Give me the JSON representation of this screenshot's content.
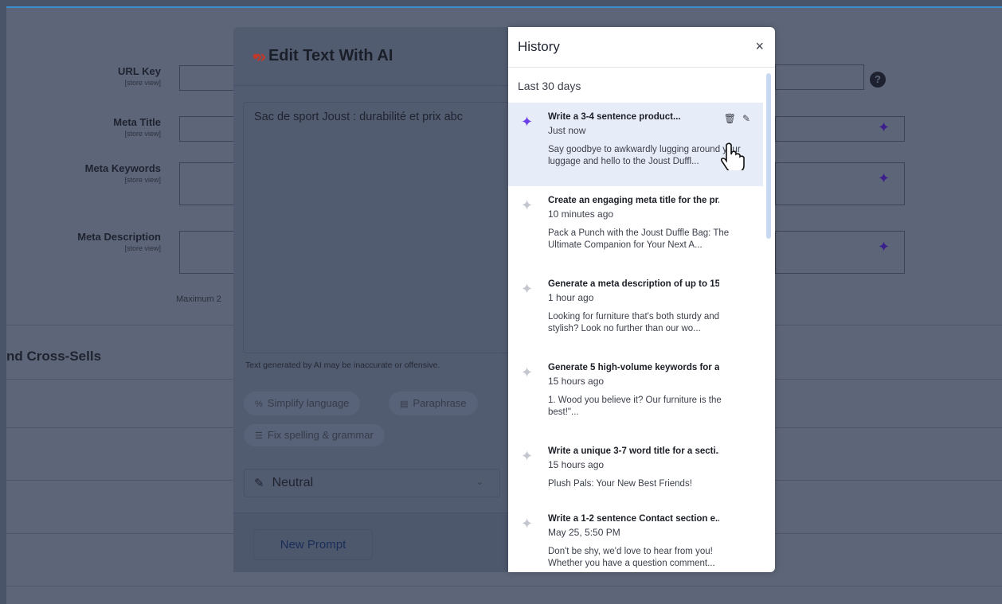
{
  "background_form": {
    "fields": [
      {
        "label": "URL Key",
        "scope": "[store view]"
      },
      {
        "label": "Meta Title",
        "scope": "[store view]"
      },
      {
        "label": "Meta Keywords",
        "scope": "[store view]"
      },
      {
        "label": "Meta Description",
        "scope": "[store view]"
      }
    ],
    "maximum_note": "Maximum 2",
    "section_title": "nd Cross-Sells",
    "help_icon": "question-circle-icon"
  },
  "modal": {
    "title": "Edit Text With AI",
    "logo": "ai-chevrons-logo",
    "text_content": "Sac de sport Joust : durabilité et prix abc",
    "disclaimer": "Text generated by AI may be inaccurate or offensive.",
    "chips": [
      "Simplify language",
      "Paraphrase",
      "Fix spelling & grammar"
    ],
    "tone": "Neutral",
    "new_prompt_label": "New Prompt"
  },
  "history": {
    "title": "History",
    "close_label": "×",
    "section": "Last 30 days",
    "items": [
      {
        "title": "Write a 3-4 sentence product...",
        "time": "Just now",
        "snippet": "Say goodbye to awkwardly lugging around your luggage and hello to the Joust Duffl..."
      },
      {
        "title": "Create an engaging meta title for the pr...",
        "time": "10 minutes ago",
        "snippet": "Pack a Punch with the Joust Duffle Bag: The Ultimate Companion for Your Next A..."
      },
      {
        "title": "Generate a meta description of up to 15...",
        "time": "1 hour ago",
        "snippet": "Looking for furniture that's both sturdy and stylish? Look no further than our wo..."
      },
      {
        "title": "Generate 5 high-volume keywords for a...",
        "time": "15 hours ago",
        "snippet": "1. Wood you believe it? Our furniture is the best!\"..."
      },
      {
        "title": "Write a unique 3-7 word title for a secti...",
        "time": "15 hours ago",
        "snippet": "Plush Pals: Your New Best Friends!"
      },
      {
        "title": "Write a 1-2 sentence Contact section e...",
        "time": "May 25, 5:50 PM",
        "snippet": "Don't be shy, we'd love to hear from you! Whether you have a question comment..."
      }
    ]
  },
  "colors": {
    "accent_purple": "#6a3ee8",
    "overlay": "#5d6678",
    "logo_red": "#c0392b"
  }
}
